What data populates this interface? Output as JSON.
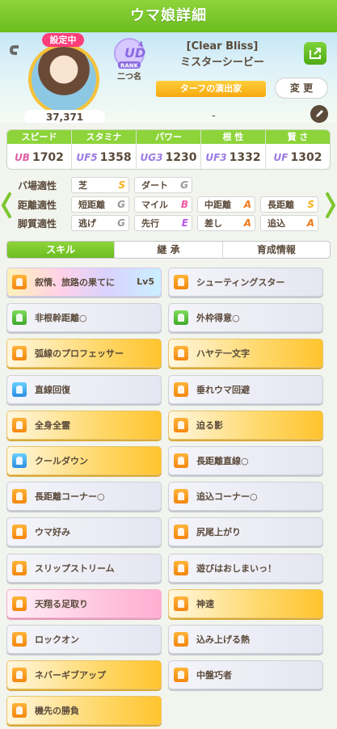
{
  "header": {
    "title": "ウマ娘詳細"
  },
  "profile": {
    "current_badge": "設定中",
    "score": "37,371",
    "rank_sub": "二つ名",
    "rank_label": "RANK",
    "rank_letters": "UD",
    "rank_num": "4",
    "title": "[Clear Bliss]",
    "name": "ミスターシービー",
    "nickname": "ターフの演出家",
    "change_label": "変 更",
    "dash": "-"
  },
  "stats": [
    {
      "label": "スピード",
      "grade": "UB",
      "value": "1702",
      "grade_color": "#e15fa6"
    },
    {
      "label": "スタミナ",
      "grade": "UF5",
      "value": "1358",
      "grade_color": "#9a7ae2"
    },
    {
      "label": "パワー",
      "grade": "UG3",
      "value": "1230",
      "grade_color": "#9a7ae2"
    },
    {
      "label": "根 性",
      "grade": "UF3",
      "value": "1332",
      "grade_color": "#9a7ae2"
    },
    {
      "label": "賢 さ",
      "grade": "UF",
      "value": "1302",
      "grade_color": "#9a7ae2"
    }
  ],
  "aptitude": {
    "ground_label": "バ場適性",
    "distance_label": "距離適性",
    "style_label": "脚質適性",
    "ground": [
      {
        "name": "芝",
        "grade": "S",
        "color": "#f4b21a"
      },
      {
        "name": "ダート",
        "grade": "G",
        "color": "#9a9a9a"
      }
    ],
    "distance": [
      {
        "name": "短距離",
        "grade": "G",
        "color": "#9a9a9a"
      },
      {
        "name": "マイル",
        "grade": "B",
        "color": "#f05aa8"
      },
      {
        "name": "中距離",
        "grade": "A",
        "color": "#f07a1a"
      },
      {
        "name": "長距離",
        "grade": "S",
        "color": "#f4b21a"
      }
    ],
    "style": [
      {
        "name": "逃げ",
        "grade": "G",
        "color": "#9a9a9a"
      },
      {
        "name": "先行",
        "grade": "E",
        "color": "#b45ae0"
      },
      {
        "name": "差し",
        "grade": "A",
        "color": "#f07a1a"
      },
      {
        "name": "追込",
        "grade": "A",
        "color": "#f07a1a"
      }
    ]
  },
  "tabs": [
    "スキル",
    "継 承",
    "育成情報"
  ],
  "skills": [
    {
      "name": "叙情、旅路の果てに",
      "lv": "Lv5",
      "style": "rainbow",
      "icon": "orange"
    },
    {
      "name": "シューティングスター",
      "lv": "",
      "style": "plain",
      "icon": "orange"
    },
    {
      "name": "非根幹距離○",
      "lv": "",
      "style": "plain",
      "icon": "green"
    },
    {
      "name": "外枠得意○",
      "lv": "",
      "style": "plain",
      "icon": "green"
    },
    {
      "name": "弧線のプロフェッサー",
      "lv": "",
      "style": "gold",
      "icon": "orange"
    },
    {
      "name": "ハヤテ一文字",
      "lv": "",
      "style": "gold",
      "icon": "orange"
    },
    {
      "name": "直線回復",
      "lv": "",
      "style": "plain",
      "icon": "blue"
    },
    {
      "name": "垂れウマ回避",
      "lv": "",
      "style": "plain",
      "icon": "orange"
    },
    {
      "name": "全身全霊",
      "lv": "",
      "style": "gold",
      "icon": "orange"
    },
    {
      "name": "迫る影",
      "lv": "",
      "style": "gold",
      "icon": "orange"
    },
    {
      "name": "クールダウン",
      "lv": "",
      "style": "gold",
      "icon": "blue"
    },
    {
      "name": "長距離直線○",
      "lv": "",
      "style": "plain",
      "icon": "orange"
    },
    {
      "name": "長距離コーナー○",
      "lv": "",
      "style": "plain",
      "icon": "orange"
    },
    {
      "name": "追込コーナー○",
      "lv": "",
      "style": "plain",
      "icon": "orange"
    },
    {
      "name": "ウマ好み",
      "lv": "",
      "style": "plain",
      "icon": "orange"
    },
    {
      "name": "尻尾上がり",
      "lv": "",
      "style": "plain",
      "icon": "orange"
    },
    {
      "name": "スリップストリーム",
      "lv": "",
      "style": "plain",
      "icon": "orange"
    },
    {
      "name": "遊びはおしまいっ！",
      "lv": "",
      "style": "plain",
      "icon": "orange"
    },
    {
      "name": "天翔る足取り",
      "lv": "",
      "style": "pink",
      "icon": "orange"
    },
    {
      "name": "神速",
      "lv": "",
      "style": "gold",
      "icon": "orange"
    },
    {
      "name": "ロックオン",
      "lv": "",
      "style": "plain",
      "icon": "orange"
    },
    {
      "name": "込み上げる熱",
      "lv": "",
      "style": "plain",
      "icon": "orange"
    },
    {
      "name": "ネバーギブアップ",
      "lv": "",
      "style": "gold",
      "icon": "orange"
    },
    {
      "name": "中盤巧者",
      "lv": "",
      "style": "plain",
      "icon": "orange"
    },
    {
      "name": "機先の勝負",
      "lv": "",
      "style": "gold",
      "icon": "orange"
    }
  ]
}
